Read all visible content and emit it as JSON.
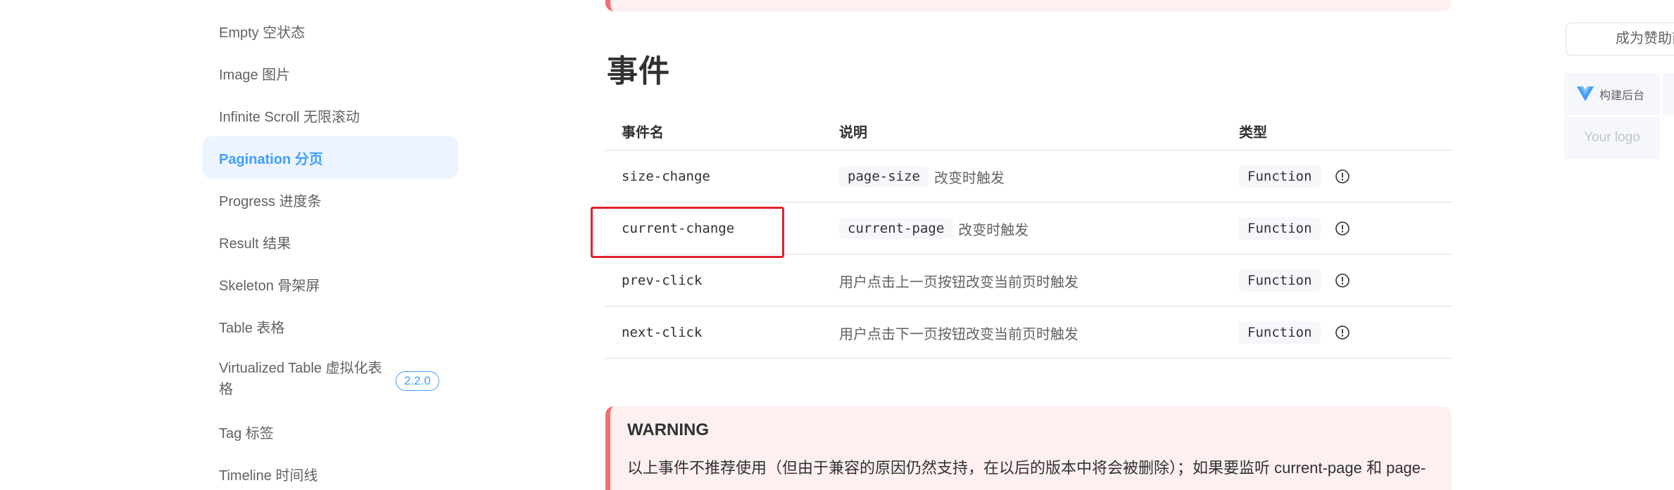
{
  "sidebar": {
    "items": [
      {
        "label": "Empty 空状态"
      },
      {
        "label": "Image 图片"
      },
      {
        "label": "Infinite Scroll 无限滚动"
      },
      {
        "label": "Pagination 分页",
        "active": true
      },
      {
        "label": "Progress 进度条"
      },
      {
        "label": "Result 结果"
      },
      {
        "label": "Skeleton 骨架屏"
      },
      {
        "label": "Table 表格"
      },
      {
        "label": "Virtualized Table 虚拟化表格",
        "badge": "2.2.0"
      },
      {
        "label": "Tag 标签"
      },
      {
        "label": "Timeline 时间线"
      }
    ]
  },
  "events": {
    "title": "事件",
    "headers": [
      "事件名",
      "说明",
      "类型"
    ],
    "rows": [
      {
        "name": "size-change",
        "desc_code": "page-size",
        "desc": "改变时触发",
        "type": "Function"
      },
      {
        "name": "current-change",
        "desc_code": "current-page",
        "desc": "改变时触发",
        "type": "Function"
      },
      {
        "name": "prev-click",
        "desc_code": "",
        "desc": "用户点击上一页按钮改变当前页时触发",
        "type": "Function"
      },
      {
        "name": "next-click",
        "desc_code": "",
        "desc": "用户点击下一页按钮改变当前页时触发",
        "type": "Function"
      }
    ]
  },
  "warning": {
    "title": "WARNING",
    "text": "以上事件不推荐使用（但由于兼容的原因仍然支持，在以后的版本中将会被删除）；如果要监听 current-page 和 page-"
  },
  "aside": {
    "sponsor_button": "成为赞助商",
    "sponsor_card": "构建后台",
    "logo_placeholder": "Your logo"
  },
  "colors": {
    "accent": "#409eff",
    "danger": "#f56c6c",
    "highlight": "#e0242e"
  }
}
